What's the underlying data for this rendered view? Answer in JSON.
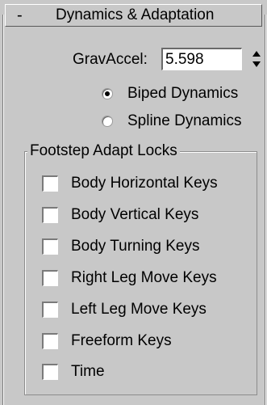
{
  "rollout": {
    "toggle_symbol": "-",
    "title": "Dynamics & Adaptation"
  },
  "grav_accel": {
    "label": "GravAccel:",
    "value": "5.598"
  },
  "dynamics_mode": {
    "options": [
      {
        "label": "Biped Dynamics",
        "selected": true
      },
      {
        "label": "Spline Dynamics",
        "selected": false
      }
    ]
  },
  "footstep_locks": {
    "legend": "Footstep Adapt Locks",
    "items": [
      {
        "label": "Body Horizontal Keys",
        "checked": false
      },
      {
        "label": "Body Vertical Keys",
        "checked": false
      },
      {
        "label": "Body Turning Keys",
        "checked": false
      },
      {
        "label": "Right Leg Move Keys",
        "checked": false
      },
      {
        "label": "Left Leg Move Keys",
        "checked": false
      },
      {
        "label": "Freeform Keys",
        "checked": false
      },
      {
        "label": "Time",
        "checked": false
      }
    ]
  }
}
